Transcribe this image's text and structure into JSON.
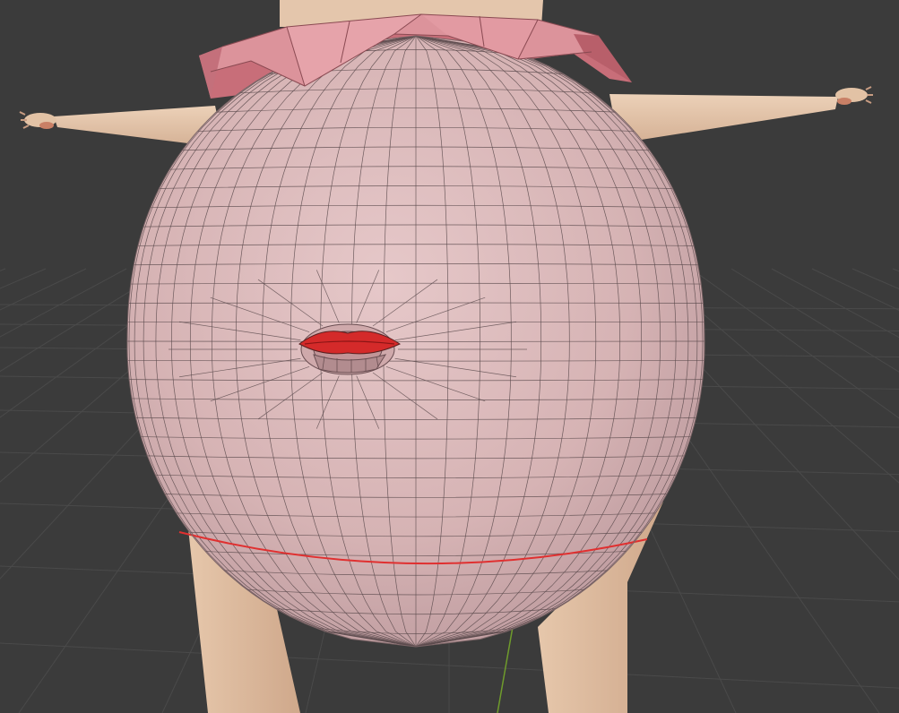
{
  "viewport": {
    "background_color": "#3b3b3b",
    "grid_color": "#4a4a4a",
    "axis_y_color": "#6f9b2c"
  },
  "model": {
    "body_color": "#d9b8b8",
    "body_shade_color": "#c9a3a4",
    "wire_color": "#5a4a4c",
    "skin_color": "#e3c4a8",
    "skin_shade_color": "#c9a48a",
    "collar_color": "#d9858f",
    "collar_dark_color": "#b8616c",
    "mouth_color": "#d42a2a",
    "selected_edge_color": "#e03030"
  }
}
